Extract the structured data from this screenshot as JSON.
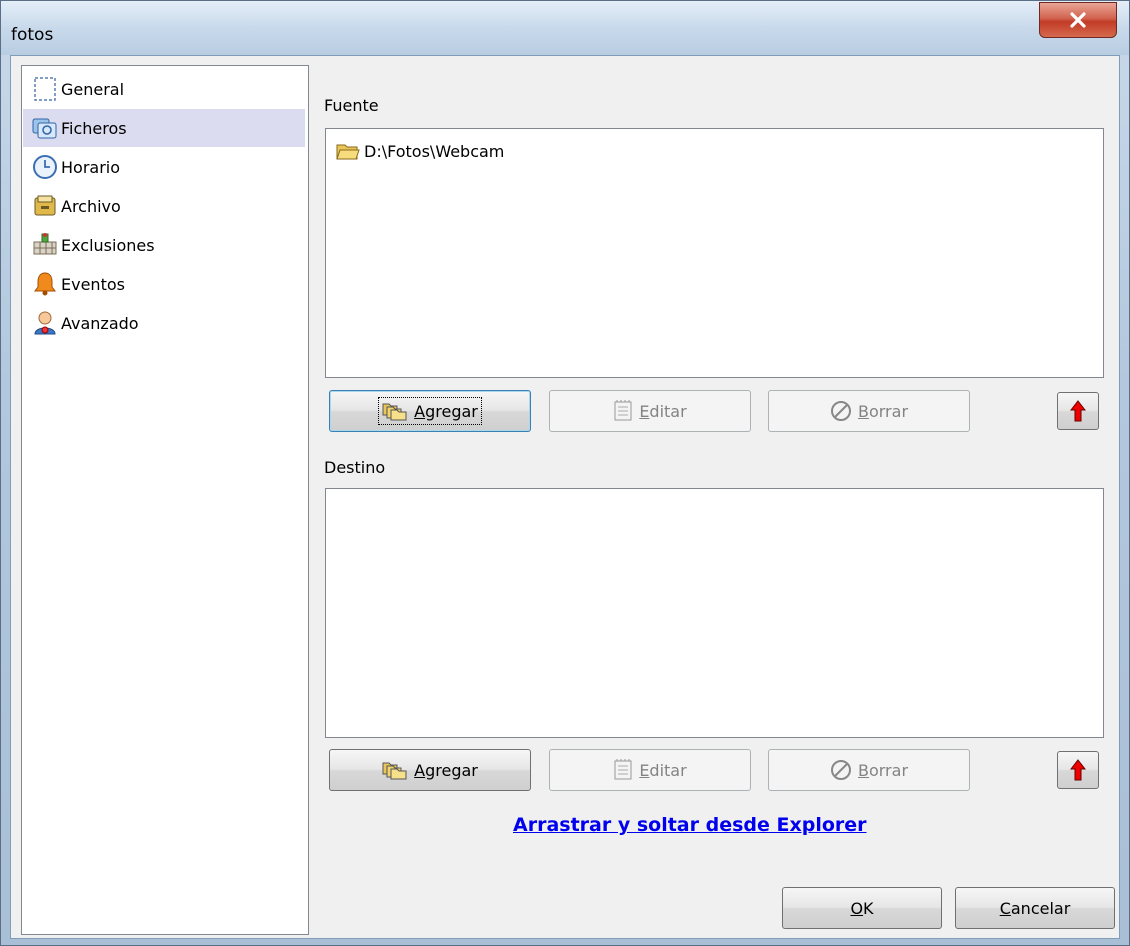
{
  "window": {
    "title": "fotos",
    "close_glyph": "✕"
  },
  "sidebar": {
    "items": [
      {
        "label": "General",
        "icon": "page-icon"
      },
      {
        "label": "Ficheros",
        "icon": "files-icon",
        "selected": true
      },
      {
        "label": "Horario",
        "icon": "clock-icon"
      },
      {
        "label": "Archivo",
        "icon": "archive-icon"
      },
      {
        "label": "Exclusiones",
        "icon": "exclusions-icon"
      },
      {
        "label": "Eventos",
        "icon": "bell-icon"
      },
      {
        "label": "Avanzado",
        "icon": "advanced-user-icon"
      }
    ]
  },
  "source": {
    "label": "Fuente",
    "items": [
      {
        "path": "D:\\Fotos\\Webcam",
        "icon": "folder-icon"
      }
    ],
    "add": {
      "mnemonic": "A",
      "rest": "gregar"
    },
    "edit": {
      "mnemonic": "E",
      "rest": "ditar"
    },
    "delete": {
      "mnemonic": "B",
      "rest": "orrar"
    }
  },
  "destination": {
    "label": "Destino",
    "items": [],
    "add": {
      "mnemonic": "A",
      "rest": "gregar"
    },
    "edit": {
      "mnemonic": "E",
      "rest": "ditar"
    },
    "delete": {
      "mnemonic": "B",
      "rest": "orrar"
    }
  },
  "drag_link": "Arrastrar y soltar desde Explorer",
  "footer": {
    "ok": {
      "mnemonic": "O",
      "rest": "K"
    },
    "cancel": {
      "mnemonic": "C",
      "rest": "ancelar"
    }
  }
}
